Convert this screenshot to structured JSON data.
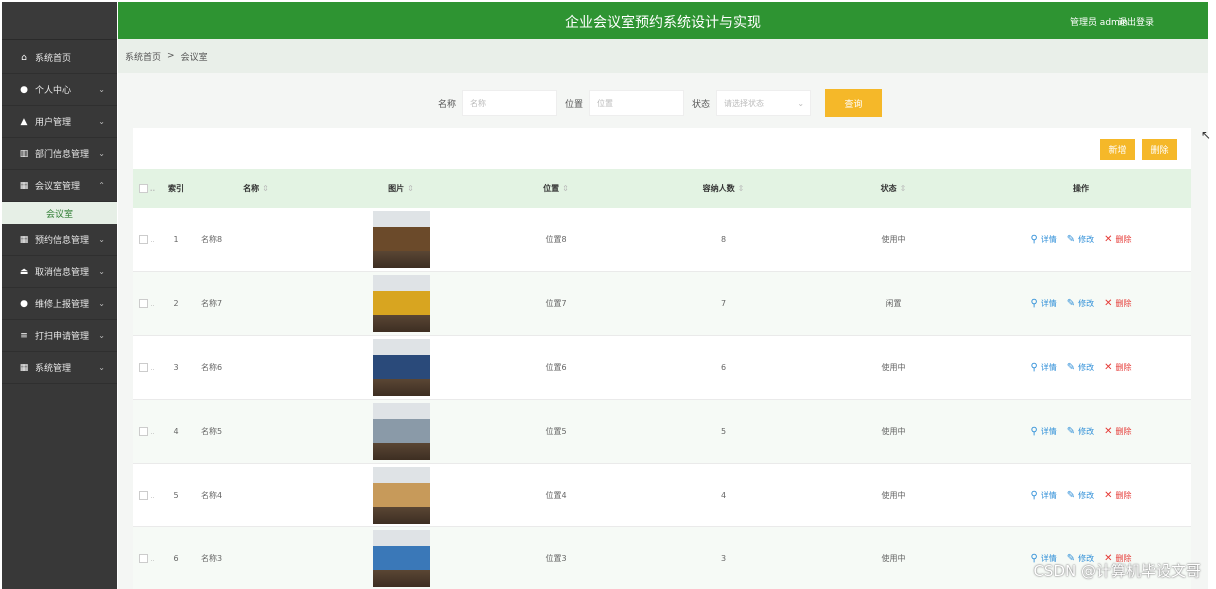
{
  "app": {
    "title": "企业会议室预约系统设计与实现",
    "user": "管理员 admin",
    "logout": "退出登录"
  },
  "colors": {
    "brand_green": "#2e9432",
    "sidebar_bg": "#383838",
    "accent_yellow": "#f5b829",
    "table_header_bg": "#e3f3e3"
  },
  "sidebar": {
    "items": [
      {
        "label": "系统首页",
        "icon": "home-icon",
        "expandable": false
      },
      {
        "label": "个人中心",
        "icon": "user-icon",
        "expandable": true
      },
      {
        "label": "用户管理",
        "icon": "thumbs-up-icon",
        "expandable": true
      },
      {
        "label": "部门信息管理",
        "icon": "chart-icon",
        "expandable": true
      },
      {
        "label": "会议室管理",
        "icon": "grid-icon",
        "expandable": true,
        "expanded": true,
        "sub": "会议室"
      },
      {
        "label": "预约信息管理",
        "icon": "grid-icon",
        "expandable": true
      },
      {
        "label": "取消信息管理",
        "icon": "eject-icon",
        "expandable": true
      },
      {
        "label": "维修上报管理",
        "icon": "pin-icon",
        "expandable": true
      },
      {
        "label": "打扫申请管理",
        "icon": "list-icon",
        "expandable": true
      },
      {
        "label": "系统管理",
        "icon": "grid-icon",
        "expandable": true
      }
    ]
  },
  "breadcrumb": {
    "home": "系统首页",
    "sep": ">",
    "current": "会议室"
  },
  "search": {
    "name_label": "名称",
    "name_placeholder": "名称",
    "location_label": "位置",
    "location_placeholder": "位置",
    "status_label": "状态",
    "status_placeholder": "请选择状态",
    "query_button": "查询"
  },
  "toolbar": {
    "add": "新增",
    "delete": "删除"
  },
  "table": {
    "headers": {
      "index": "索引",
      "name": "名称",
      "image": "图片",
      "location": "位置",
      "capacity": "容纳人数",
      "status": "状态",
      "ops": "操作"
    },
    "ops": {
      "detail": "详情",
      "edit": "修改",
      "delete": "删除"
    },
    "rows": [
      {
        "index": "1",
        "name": "名称8",
        "location": "位置8",
        "capacity": "8",
        "status": "使用中",
        "thumb_color": "#6b4a2a"
      },
      {
        "index": "2",
        "name": "名称7",
        "location": "位置7",
        "capacity": "7",
        "status": "闲置",
        "thumb_color": "#d8a520"
      },
      {
        "index": "3",
        "name": "名称6",
        "location": "位置6",
        "capacity": "6",
        "status": "使用中",
        "thumb_color": "#2a4a7a"
      },
      {
        "index": "4",
        "name": "名称5",
        "location": "位置5",
        "capacity": "5",
        "status": "使用中",
        "thumb_color": "#8a9aa8"
      },
      {
        "index": "5",
        "name": "名称4",
        "location": "位置4",
        "capacity": "4",
        "status": "使用中",
        "thumb_color": "#c79a5a"
      },
      {
        "index": "6",
        "name": "名称3",
        "location": "位置3",
        "capacity": "3",
        "status": "使用中",
        "thumb_color": "#3a78b8"
      }
    ]
  },
  "watermark": "CSDN @计算机毕设文哥"
}
